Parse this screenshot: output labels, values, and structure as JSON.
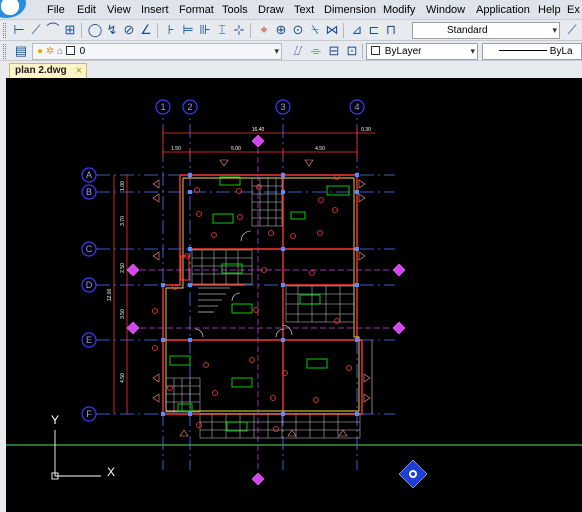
{
  "menu": {
    "items": [
      "File",
      "Edit",
      "View",
      "Insert",
      "Format",
      "Tools",
      "Draw",
      "Text",
      "Dimension",
      "Modify",
      "Window",
      "Application",
      "Help",
      "Ex"
    ]
  },
  "toolbar": {
    "text_style_value": "Standard",
    "layer_value": "0",
    "color_value": "ByLayer",
    "linetype_value": "ByLa"
  },
  "tabs": {
    "active_label": "plan 2.dwg",
    "close_glyph": "×"
  },
  "drawing": {
    "column_labels": [
      "1",
      "2",
      "3",
      "4"
    ],
    "row_labels": [
      "A",
      "B",
      "C",
      "D",
      "E",
      "F"
    ],
    "overall_dim": "16.40",
    "right_dim": "0.30",
    "dim_a": "1.50",
    "dim_b": "5.00",
    "dim_c": "4.50",
    "vert_dims": [
      "1.00",
      "3.70",
      "2.50",
      "3.50",
      "4.50",
      "12.00"
    ],
    "ucs": {
      "y_label": "Y",
      "x_label": "X"
    },
    "colors": {
      "grid_line": "#4c79ff",
      "axis_bubble": "#3b3bff",
      "wall": "#ff3333",
      "wall_fill": "#ffd84a",
      "hatch": "#d0d0d0",
      "room_tag": "#00ff00",
      "dimension": "#ff3333",
      "ground_line": "#3bb84a",
      "section_marker": "#d046f0"
    }
  }
}
